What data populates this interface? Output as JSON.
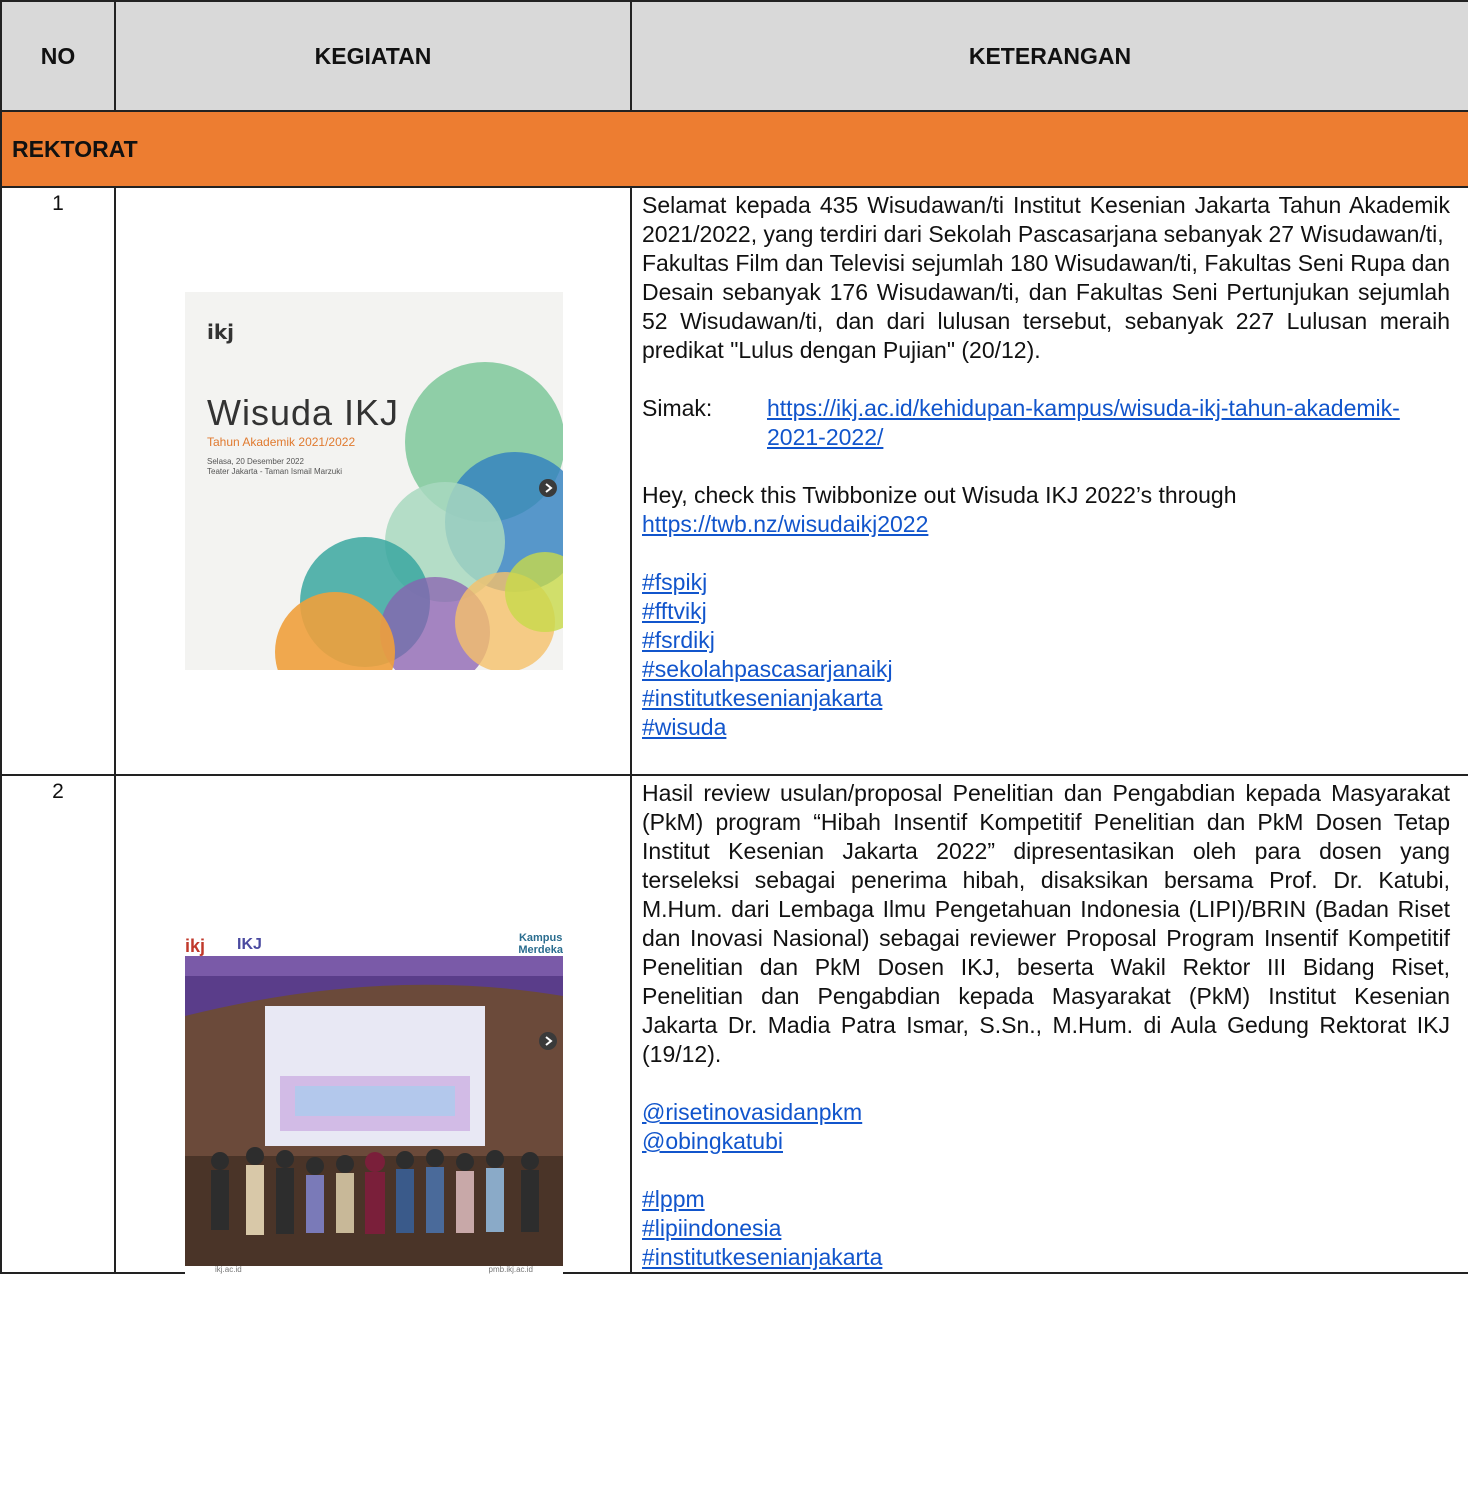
{
  "header": {
    "no": "NO",
    "kegiatan": "KEGIATAN",
    "keterangan": "KETERANGAN"
  },
  "section": "REKTORAT",
  "rows": [
    {
      "no": "1",
      "poster": {
        "logo": "ikj",
        "title": "Wisuda IKJ",
        "subtitle": "Tahun Akademik 2021/2022",
        "date": "Selasa, 20 Desember 2022\nTeater Jakarta - Taman Ismail Marzuki"
      },
      "desc": "Selamat kepada 435 Wisudawan/ti Institut Kesenian Jakarta Tahun Akademik 2021/2022, yang terdiri dari Sekolah Pascasarjana sebanyak 27 Wisudawan/ti,",
      "desc2": "Fakultas Film dan Televisi sejumlah 180 Wisudawan/ti, Fakultas Seni Rupa dan Desain sebanyak 176 Wisudawan/ti, dan Fakultas Seni Pertunjukan sejumlah 52 Wisudawan/ti, dan dari lulusan tersebut, sebanyak 227 Lulusan meraih predikat \"Lulus dengan Pujian\" (20/12).",
      "simak_label": "Simak:",
      "simak_link": "https://ikj.ac.id/kehidupan-kampus/wisuda-ikj-tahun-akademik-2021-2022/",
      "twibbon_text": "Hey, check this Twibbonize out Wisuda IKJ 2022’s through",
      "twibbon_link": "https://twb.nz/wisudaikj2022",
      "tags": [
        "#fspikj",
        "#fftvikj",
        "#fsrdikj",
        "#sekolahpascasarjanaikj",
        "#institutkesenianjakarta",
        "#wisuda"
      ]
    },
    {
      "no": "2",
      "poster": {
        "logo": "ikj",
        "logo2": "IKJ",
        "kampus": "Kampus\nMerdeka",
        "foot_left": "ikj.ac.id",
        "foot_right": "pmb.ikj.ac.id"
      },
      "desc": "Hasil review usulan/proposal Penelitian dan Pengabdian kepada Masyarakat (PkM) program “Hibah Insentif Kompetitif Penelitian dan PkM Dosen Tetap Institut Kesenian Jakarta 2022” dipresentasikan oleh para dosen yang terseleksi sebagai penerima hibah, disaksikan bersama Prof. Dr. Katubi, M.Hum. dari Lembaga Ilmu Pengetahuan Indonesia (LIPI)/BRIN (Badan Riset dan Inovasi Nasional) sebagai reviewer Proposal Program Insentif Kompetitif Penelitian dan PkM Dosen IKJ, beserta Wakil Rektor III Bidang Riset, Penelitian dan Pengabdian kepada Masyarakat (PkM) Institut Kesenian Jakarta Dr. Madia Patra Ismar, S.Sn., M.Hum. di Aula Gedung Rektorat IKJ (19/12).",
      "mentions": [
        "@risetinovasidanpkm",
        "@obingkatubi"
      ],
      "tags": [
        "#lppm",
        "#lipiindonesia",
        "#institutkesenianjakarta"
      ]
    }
  ]
}
